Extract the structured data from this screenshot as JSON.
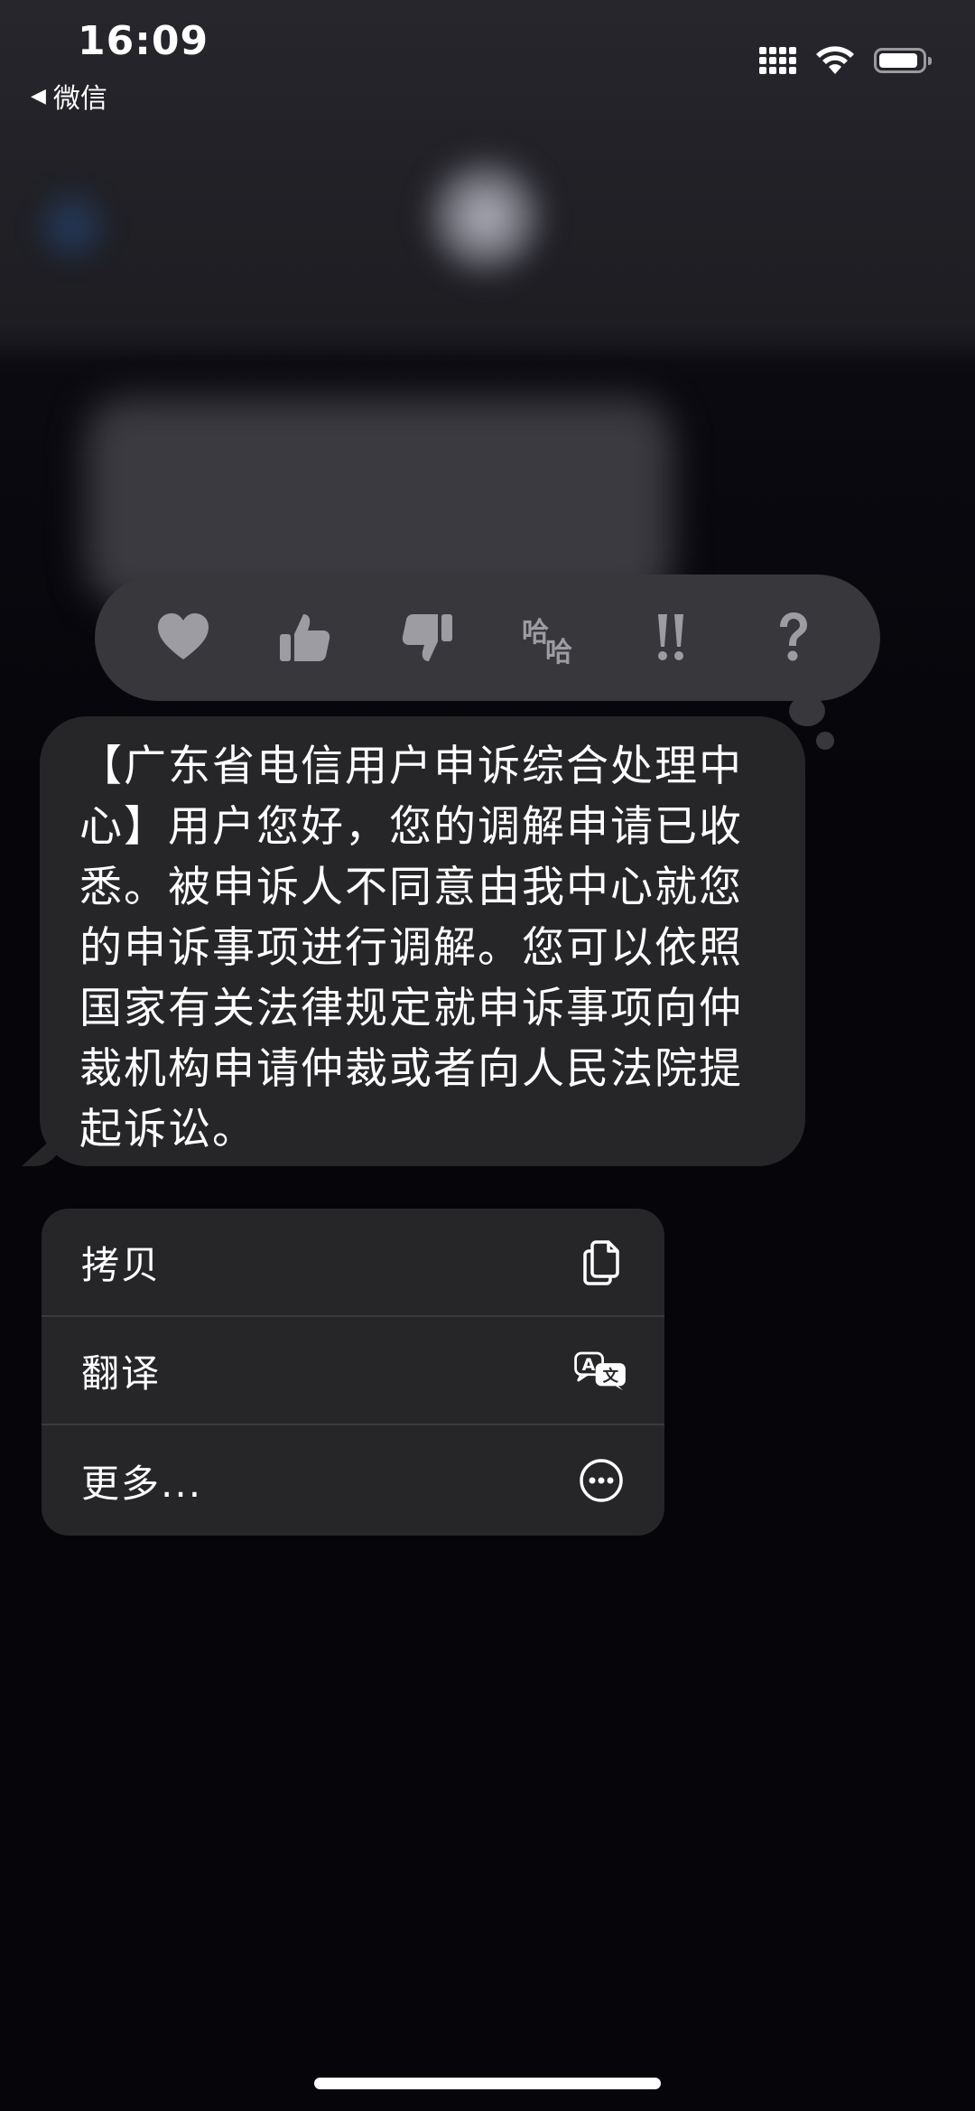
{
  "status_bar": {
    "time": "16:09",
    "back_app": "微信"
  },
  "tapbacks": [
    {
      "icon": "heart-icon"
    },
    {
      "icon": "thumbs-up-icon"
    },
    {
      "icon": "thumbs-down-icon"
    },
    {
      "icon": "haha-icon"
    },
    {
      "icon": "exclamation-icon"
    },
    {
      "icon": "question-icon"
    }
  ],
  "message": {
    "text": "【广东省电信用户申诉综合处理中心】用户您好，您的调解申请已收悉。被申诉人不同意由我中心就您的申诉事项进行调解。您可以依照国家有关法律规定就申诉事项向仲裁机构申请仲裁或者向人民法院提起诉讼。"
  },
  "context_menu": {
    "items": [
      {
        "label": "拷贝",
        "icon": "copy-icon"
      },
      {
        "label": "翻译",
        "icon": "translate-icon"
      },
      {
        "label": "更多...",
        "icon": "more-icon"
      }
    ]
  },
  "colors": {
    "bubble": "#262629",
    "tapback_bar": "#38383c",
    "icon_gray": "#9c9ca2"
  }
}
